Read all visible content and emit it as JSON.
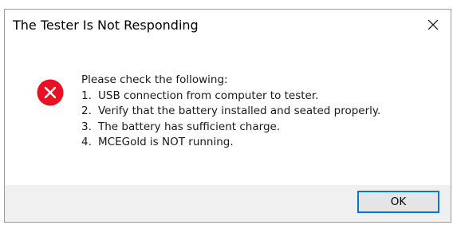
{
  "dialog": {
    "title": "The Tester Is Not Responding",
    "close_glyph": "✕",
    "icon": "error-icon",
    "colors": {
      "error_red": "#e81123",
      "accent": "#0078d7",
      "footer_bg": "#f0f0f0"
    },
    "message": {
      "intro": "Please check the following:",
      "items": [
        {
          "num": "1.",
          "text": "USB connection from computer to tester."
        },
        {
          "num": "2.",
          "text": "Verify that the battery installed and seated properly."
        },
        {
          "num": "3.",
          "text": "The battery has sufficient charge."
        },
        {
          "num": "4.",
          "text": "MCEGold is NOT running."
        }
      ]
    },
    "ok_label": "OK"
  }
}
